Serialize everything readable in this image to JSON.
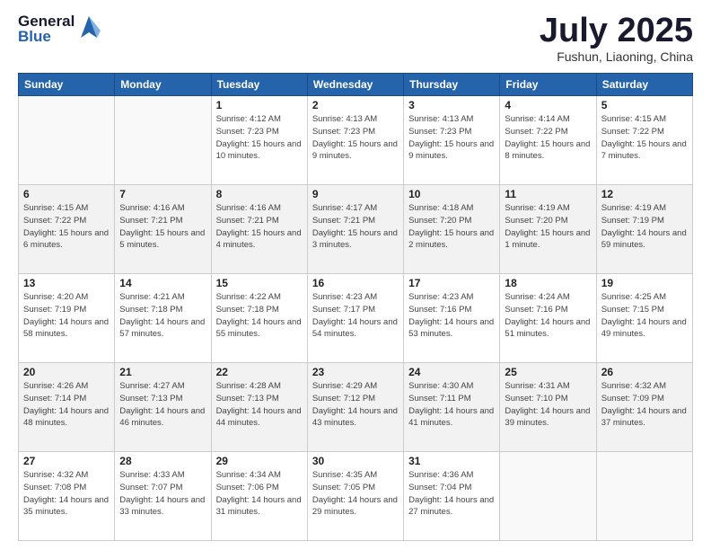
{
  "logo": {
    "general": "General",
    "blue": "Blue"
  },
  "header": {
    "month": "July 2025",
    "location": "Fushun, Liaoning, China"
  },
  "weekdays": [
    "Sunday",
    "Monday",
    "Tuesday",
    "Wednesday",
    "Thursday",
    "Friday",
    "Saturday"
  ],
  "weeks": [
    [
      {
        "day": "",
        "sunrise": "",
        "sunset": "",
        "daylight": ""
      },
      {
        "day": "",
        "sunrise": "",
        "sunset": "",
        "daylight": ""
      },
      {
        "day": "1",
        "sunrise": "Sunrise: 4:12 AM",
        "sunset": "Sunset: 7:23 PM",
        "daylight": "Daylight: 15 hours and 10 minutes."
      },
      {
        "day": "2",
        "sunrise": "Sunrise: 4:13 AM",
        "sunset": "Sunset: 7:23 PM",
        "daylight": "Daylight: 15 hours and 9 minutes."
      },
      {
        "day": "3",
        "sunrise": "Sunrise: 4:13 AM",
        "sunset": "Sunset: 7:23 PM",
        "daylight": "Daylight: 15 hours and 9 minutes."
      },
      {
        "day": "4",
        "sunrise": "Sunrise: 4:14 AM",
        "sunset": "Sunset: 7:22 PM",
        "daylight": "Daylight: 15 hours and 8 minutes."
      },
      {
        "day": "5",
        "sunrise": "Sunrise: 4:15 AM",
        "sunset": "Sunset: 7:22 PM",
        "daylight": "Daylight: 15 hours and 7 minutes."
      }
    ],
    [
      {
        "day": "6",
        "sunrise": "Sunrise: 4:15 AM",
        "sunset": "Sunset: 7:22 PM",
        "daylight": "Daylight: 15 hours and 6 minutes."
      },
      {
        "day": "7",
        "sunrise": "Sunrise: 4:16 AM",
        "sunset": "Sunset: 7:21 PM",
        "daylight": "Daylight: 15 hours and 5 minutes."
      },
      {
        "day": "8",
        "sunrise": "Sunrise: 4:16 AM",
        "sunset": "Sunset: 7:21 PM",
        "daylight": "Daylight: 15 hours and 4 minutes."
      },
      {
        "day": "9",
        "sunrise": "Sunrise: 4:17 AM",
        "sunset": "Sunset: 7:21 PM",
        "daylight": "Daylight: 15 hours and 3 minutes."
      },
      {
        "day": "10",
        "sunrise": "Sunrise: 4:18 AM",
        "sunset": "Sunset: 7:20 PM",
        "daylight": "Daylight: 15 hours and 2 minutes."
      },
      {
        "day": "11",
        "sunrise": "Sunrise: 4:19 AM",
        "sunset": "Sunset: 7:20 PM",
        "daylight": "Daylight: 15 hours and 1 minute."
      },
      {
        "day": "12",
        "sunrise": "Sunrise: 4:19 AM",
        "sunset": "Sunset: 7:19 PM",
        "daylight": "Daylight: 14 hours and 59 minutes."
      }
    ],
    [
      {
        "day": "13",
        "sunrise": "Sunrise: 4:20 AM",
        "sunset": "Sunset: 7:19 PM",
        "daylight": "Daylight: 14 hours and 58 minutes."
      },
      {
        "day": "14",
        "sunrise": "Sunrise: 4:21 AM",
        "sunset": "Sunset: 7:18 PM",
        "daylight": "Daylight: 14 hours and 57 minutes."
      },
      {
        "day": "15",
        "sunrise": "Sunrise: 4:22 AM",
        "sunset": "Sunset: 7:18 PM",
        "daylight": "Daylight: 14 hours and 55 minutes."
      },
      {
        "day": "16",
        "sunrise": "Sunrise: 4:23 AM",
        "sunset": "Sunset: 7:17 PM",
        "daylight": "Daylight: 14 hours and 54 minutes."
      },
      {
        "day": "17",
        "sunrise": "Sunrise: 4:23 AM",
        "sunset": "Sunset: 7:16 PM",
        "daylight": "Daylight: 14 hours and 53 minutes."
      },
      {
        "day": "18",
        "sunrise": "Sunrise: 4:24 AM",
        "sunset": "Sunset: 7:16 PM",
        "daylight": "Daylight: 14 hours and 51 minutes."
      },
      {
        "day": "19",
        "sunrise": "Sunrise: 4:25 AM",
        "sunset": "Sunset: 7:15 PM",
        "daylight": "Daylight: 14 hours and 49 minutes."
      }
    ],
    [
      {
        "day": "20",
        "sunrise": "Sunrise: 4:26 AM",
        "sunset": "Sunset: 7:14 PM",
        "daylight": "Daylight: 14 hours and 48 minutes."
      },
      {
        "day": "21",
        "sunrise": "Sunrise: 4:27 AM",
        "sunset": "Sunset: 7:13 PM",
        "daylight": "Daylight: 14 hours and 46 minutes."
      },
      {
        "day": "22",
        "sunrise": "Sunrise: 4:28 AM",
        "sunset": "Sunset: 7:13 PM",
        "daylight": "Daylight: 14 hours and 44 minutes."
      },
      {
        "day": "23",
        "sunrise": "Sunrise: 4:29 AM",
        "sunset": "Sunset: 7:12 PM",
        "daylight": "Daylight: 14 hours and 43 minutes."
      },
      {
        "day": "24",
        "sunrise": "Sunrise: 4:30 AM",
        "sunset": "Sunset: 7:11 PM",
        "daylight": "Daylight: 14 hours and 41 minutes."
      },
      {
        "day": "25",
        "sunrise": "Sunrise: 4:31 AM",
        "sunset": "Sunset: 7:10 PM",
        "daylight": "Daylight: 14 hours and 39 minutes."
      },
      {
        "day": "26",
        "sunrise": "Sunrise: 4:32 AM",
        "sunset": "Sunset: 7:09 PM",
        "daylight": "Daylight: 14 hours and 37 minutes."
      }
    ],
    [
      {
        "day": "27",
        "sunrise": "Sunrise: 4:32 AM",
        "sunset": "Sunset: 7:08 PM",
        "daylight": "Daylight: 14 hours and 35 minutes."
      },
      {
        "day": "28",
        "sunrise": "Sunrise: 4:33 AM",
        "sunset": "Sunset: 7:07 PM",
        "daylight": "Daylight: 14 hours and 33 minutes."
      },
      {
        "day": "29",
        "sunrise": "Sunrise: 4:34 AM",
        "sunset": "Sunset: 7:06 PM",
        "daylight": "Daylight: 14 hours and 31 minutes."
      },
      {
        "day": "30",
        "sunrise": "Sunrise: 4:35 AM",
        "sunset": "Sunset: 7:05 PM",
        "daylight": "Daylight: 14 hours and 29 minutes."
      },
      {
        "day": "31",
        "sunrise": "Sunrise: 4:36 AM",
        "sunset": "Sunset: 7:04 PM",
        "daylight": "Daylight: 14 hours and 27 minutes."
      },
      {
        "day": "",
        "sunrise": "",
        "sunset": "",
        "daylight": ""
      },
      {
        "day": "",
        "sunrise": "",
        "sunset": "",
        "daylight": ""
      }
    ]
  ]
}
